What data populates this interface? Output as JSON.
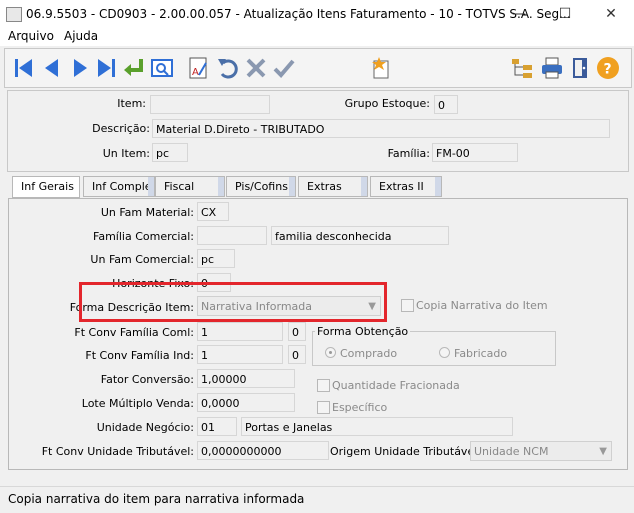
{
  "window": {
    "title": "06.9.5503 - CD0903 - 2.00.00.057 - Atualização Itens Faturamento - 10 - TOTVS S.A. Seg...",
    "minimize": "—",
    "maximize": "☐",
    "close": "✕"
  },
  "menu": {
    "arquivo": "Arquivo",
    "ajuda": "Ajuda"
  },
  "header": {
    "item_label": "Item:",
    "item_value": "",
    "grupo_estoque_label": "Grupo Estoque:",
    "grupo_estoque_value": "0",
    "descricao_label": "Descrição:",
    "descricao_value": "Material D.Direto - TRIBUTADO",
    "un_item_label": "Un Item:",
    "un_item_value": "pc",
    "familia_label": "Família:",
    "familia_value": "FM-00"
  },
  "tabs": [
    "Inf Gerais",
    "Inf Compler",
    "Fiscal",
    "Pis/Cofins",
    "Extras",
    "Extras II"
  ],
  "form": {
    "un_fam_material_label": "Un Fam Material:",
    "un_fam_material_value": "CX",
    "familia_comercial_label": "Família Comercial:",
    "familia_comercial_value": "",
    "familia_comercial_desc": "familia desconhecida",
    "un_fam_comercial_label": "Un Fam Comercial:",
    "un_fam_comercial_value": "pc",
    "horizonte_fixo_label": "Horizonte Fixo:",
    "horizonte_fixo_value": "0",
    "forma_descricao_label": "Forma Descrição Item:",
    "forma_descricao_value": "Narrativa Informada",
    "copia_narrativa_label": "Copia Narrativa do Item",
    "ft_conv_familia_coml_label": "Ft Conv Família Coml:",
    "ft_conv_familia_coml_value": "1",
    "ft_conv_familia_coml_dec": "0",
    "ft_conv_familia_ind_label": "Ft Conv Família Ind:",
    "ft_conv_familia_ind_value": "1",
    "ft_conv_familia_ind_dec": "0",
    "forma_obtencao_label": "Forma Obtenção",
    "comprado_label": "Comprado",
    "fabricado_label": "Fabricado",
    "fator_conversao_label": "Fator Conversão:",
    "fator_conversao_value": "1,00000",
    "quantidade_fracionada_label": "Quantidade Fracionada",
    "lote_multiplo_label": "Lote Múltiplo Venda:",
    "lote_multiplo_value": "0,0000",
    "especifico_label": "Específico",
    "unidade_negocio_label": "Unidade Negócio:",
    "unidade_negocio_value": "01",
    "unidade_negocio_desc": "Portas e Janelas",
    "ft_conv_unidade_trib_label": "Ft Conv Unidade Tributável:",
    "ft_conv_unidade_trib_value": "0,0000000000",
    "origem_unidade_trib_label": "Origem Unidade Tributável:",
    "origem_unidade_trib_value": "Unidade NCM"
  },
  "status": {
    "text": "Copia narrativa do item para narrativa informada"
  },
  "colors": {
    "highlight": "#e3262c",
    "toolbar_blue": "#2f6fd6",
    "toolbar_green": "#5aa02c"
  }
}
